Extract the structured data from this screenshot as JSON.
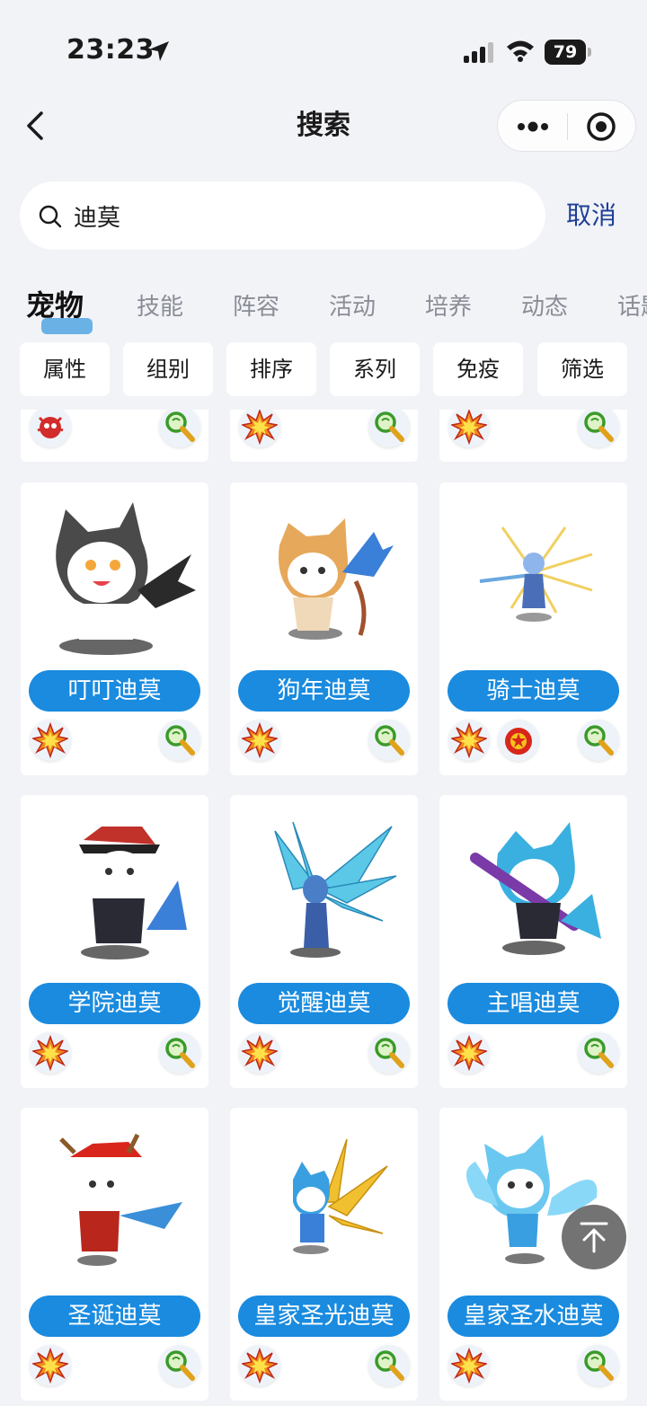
{
  "status_bar": {
    "time": "23:23",
    "battery": "79"
  },
  "nav": {
    "title": "搜索"
  },
  "search": {
    "value": "迪莫",
    "placeholder": "",
    "cancel_label": "取消"
  },
  "tabs": [
    "宠物",
    "技能",
    "阵容",
    "活动",
    "培养",
    "动态",
    "话题"
  ],
  "filters": [
    "属性",
    "组别",
    "排序",
    "系列",
    "免疫",
    "筛选"
  ],
  "pets": [
    {
      "name": "叮叮迪莫",
      "icons": [
        "explosion-icon",
        "search-icon"
      ]
    },
    {
      "name": "狗年迪莫",
      "icons": [
        "explosion-icon",
        "search-icon"
      ]
    },
    {
      "name": "骑士迪莫",
      "icons": [
        "explosion-icon",
        "fire-orb-icon",
        "search-icon"
      ]
    },
    {
      "name": "学院迪莫",
      "icons": [
        "explosion-icon",
        "search-icon"
      ]
    },
    {
      "name": "觉醒迪莫",
      "icons": [
        "explosion-icon",
        "search-icon"
      ]
    },
    {
      "name": "主唱迪莫",
      "icons": [
        "explosion-icon",
        "search-icon"
      ]
    },
    {
      "name": "圣诞迪莫",
      "icons": [
        "explosion-icon",
        "search-icon"
      ]
    },
    {
      "name": "皇家圣光迪莫",
      "icons": [
        "explosion-icon",
        "search-icon"
      ]
    },
    {
      "name": "皇家圣水迪莫",
      "icons": [
        "explosion-icon",
        "search-icon"
      ]
    }
  ],
  "colors": {
    "accent": "#1a8bdf",
    "cancel": "#1e3f96",
    "background": "#f2f3f7"
  }
}
